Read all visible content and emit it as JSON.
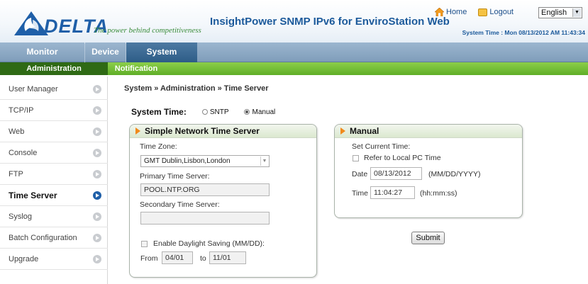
{
  "brand": {
    "name": "DELTA",
    "tagline": "The power behind competitiveness"
  },
  "header": {
    "title": "InsightPower SNMP IPv6 for EnviroStation Web",
    "home_label": "Home",
    "logout_label": "Logout",
    "language": "English",
    "system_time": "System Time : Mon 08/13/2012 AM 11:43:34"
  },
  "nav": {
    "main_tabs": [
      {
        "label": "Monitor"
      },
      {
        "label": "Device"
      },
      {
        "label": "System"
      }
    ],
    "sub_tabs": [
      {
        "label": "Administration"
      },
      {
        "label": "Notification"
      }
    ]
  },
  "sidebar": {
    "items": [
      {
        "label": "User Manager"
      },
      {
        "label": "TCP/IP"
      },
      {
        "label": "Web"
      },
      {
        "label": "Console"
      },
      {
        "label": "FTP"
      },
      {
        "label": "Time Server"
      },
      {
        "label": "Syslog"
      },
      {
        "label": "Batch Configuration"
      },
      {
        "label": "Upgrade"
      }
    ]
  },
  "main": {
    "breadcrumb": "System » Administration » Time Server",
    "system_time_label": "System Time:",
    "mode_options": [
      "SNTP",
      "Manual"
    ],
    "selected_mode": "Manual",
    "sntp": {
      "title": "Simple Network Time Server",
      "time_zone_label": "Time Zone:",
      "time_zone_value": "GMT Dublin,Lisbon,London",
      "primary_label": "Primary Time Server:",
      "primary_value": "POOL.NTP.ORG",
      "secondary_label": "Secondary Time Server:",
      "secondary_value": "",
      "dst_label": "Enable Daylight Saving (MM/DD):",
      "from_label": "From",
      "from_value": "04/01",
      "to_label": "to",
      "to_value": "11/01"
    },
    "manual": {
      "title": "Manual",
      "set_label": "Set Current Time:",
      "refer_label": "Refer to Local PC Time",
      "date_label": "Date",
      "date_value": "08/13/2012",
      "date_format": "(MM/DD/YYYY)",
      "time_label": "Time",
      "time_value": "11:04:27",
      "time_format": "(hh:mm:ss)"
    },
    "submit_label": "Submit"
  }
}
